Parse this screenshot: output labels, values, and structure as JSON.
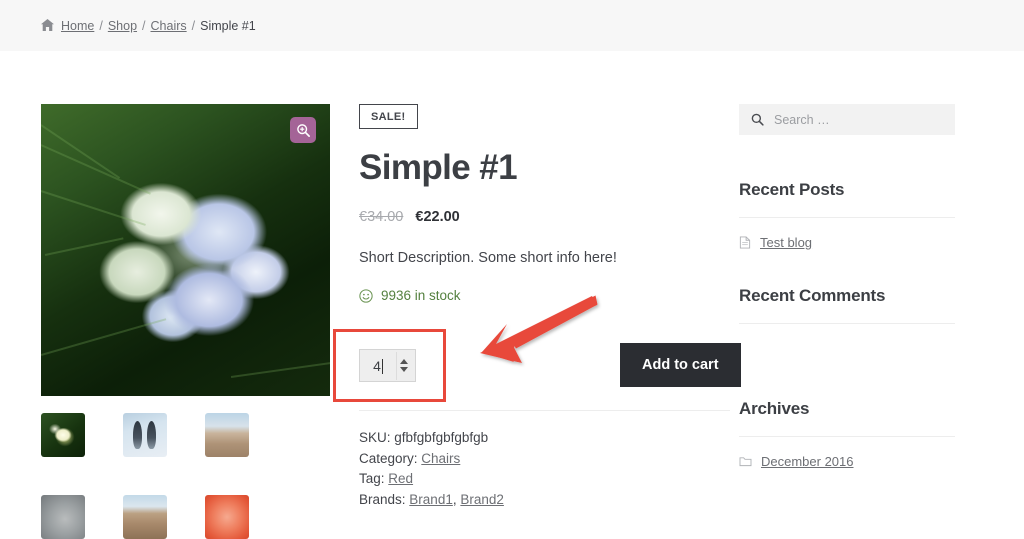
{
  "breadcrumb": {
    "home_icon": "home-icon",
    "items": [
      {
        "label": "Home",
        "link": true
      },
      {
        "label": "Shop",
        "link": true
      },
      {
        "label": "Chairs",
        "link": true
      },
      {
        "label": "Simple #1",
        "link": false
      }
    ],
    "separator": "/"
  },
  "gallery": {
    "zoom_button_icon": "magnifier-plus-icon",
    "zoom_button_color": "#a46497",
    "main_image_alt": "Hydrangea flower close-up",
    "thumbnails": [
      {
        "alt": "White flower on dark green leaves"
      },
      {
        "alt": "Two penguins"
      },
      {
        "alt": "Desert landscape"
      },
      {
        "alt": "Koala"
      },
      {
        "alt": "Desert cliff"
      },
      {
        "alt": "Orange flower"
      }
    ]
  },
  "product": {
    "sale_badge": "SALE!",
    "title": "Simple #1",
    "price_old": "€34.00",
    "price_new": "€22.00",
    "short_description": "Short Description. Some short info here!",
    "stock_icon": "smiley-face-icon",
    "stock_text": "9936 in stock",
    "stock_color": "#54803f",
    "quantity_value": "4",
    "add_to_cart_label": "Add to cart",
    "add_to_cart_color": "#2b2d32",
    "meta": {
      "sku_label": "SKU:",
      "sku_value": "gfbfgbfgbfgbfgb",
      "category_label": "Category:",
      "category_value": "Chairs",
      "tag_label": "Tag:",
      "tag_value": "Red",
      "brands_label": "Brands:",
      "brands_values": [
        "Brand1",
        "Brand2"
      ],
      "brands_separator": ", "
    }
  },
  "annotation": {
    "arrow_color": "#e8483b",
    "highlight_color": "#e8483b",
    "highlight_target": "quantity-field"
  },
  "sidebar": {
    "search": {
      "icon": "search-icon",
      "placeholder": "Search …",
      "value": ""
    },
    "widgets": [
      {
        "title": "Recent Posts",
        "items": [
          {
            "icon": "document-icon",
            "label": "Test blog"
          }
        ]
      },
      {
        "title": "Recent Comments",
        "items": []
      },
      {
        "title": "Archives",
        "items": [
          {
            "icon": "folder-icon",
            "label": "December 2016"
          }
        ]
      }
    ]
  }
}
